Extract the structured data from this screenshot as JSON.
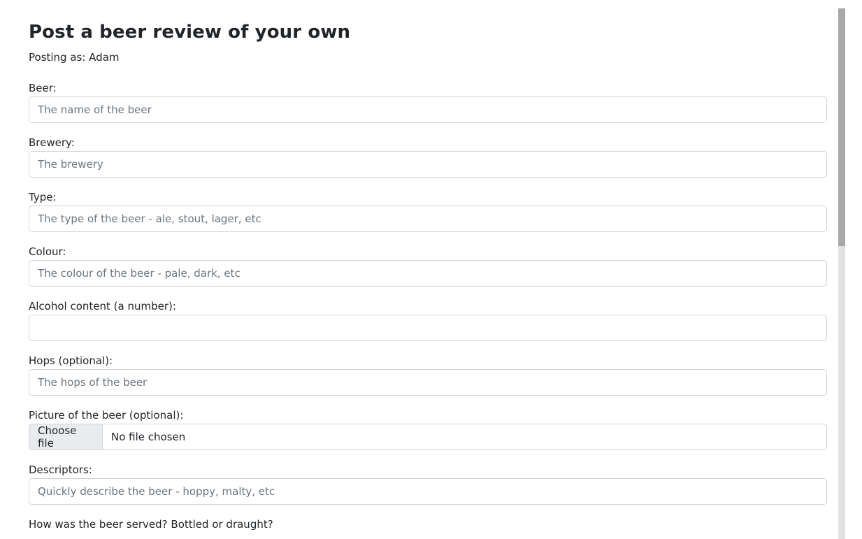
{
  "page": {
    "title": "Post a beer review of your own",
    "posting_as": "Posting as: Adam"
  },
  "form": {
    "beer": {
      "label": "Beer:",
      "placeholder": "The name of the beer",
      "value": ""
    },
    "brewery": {
      "label": "Brewery:",
      "placeholder": "The brewery",
      "value": ""
    },
    "type": {
      "label": "Type:",
      "placeholder": "The type of the beer - ale, stout, lager, etc",
      "value": ""
    },
    "colour": {
      "label": "Colour:",
      "placeholder": "The colour of the beer - pale, dark, etc",
      "value": ""
    },
    "alcohol": {
      "label": "Alcohol content (a number):",
      "placeholder": "",
      "value": ""
    },
    "hops": {
      "label": "Hops (optional):",
      "placeholder": "The hops of the beer",
      "value": ""
    },
    "picture": {
      "label": "Picture of the beer (optional):",
      "button_label": "Choose file",
      "status": "No file chosen"
    },
    "descriptors": {
      "label": "Descriptors:",
      "placeholder": "Quickly describe the beer - hoppy, malty, etc",
      "value": ""
    },
    "served_question": "How was the beer served? Bottled or draught?"
  },
  "colors": {
    "text": "#212529",
    "placeholder": "#6c757d",
    "border": "#ced4da",
    "file_button_bg": "#e9ecef",
    "scrollbar_track": "#e1e1e1",
    "scrollbar_thumb": "#a8a8a8"
  }
}
